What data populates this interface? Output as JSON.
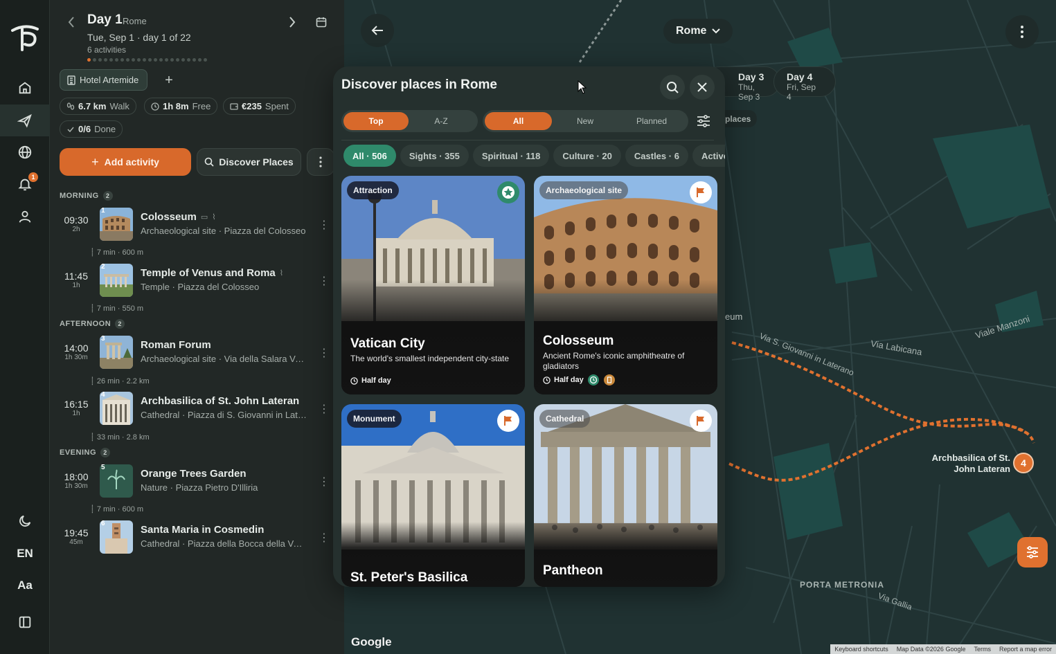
{
  "rail": {
    "items": [
      "home",
      "trips",
      "explore",
      "notifications",
      "profile"
    ],
    "notification_count": "1",
    "language": "EN",
    "font_label": "Aa"
  },
  "day": {
    "title": "Day 1",
    "city": "Rome",
    "subtitle": "Tue, Sep 1 · day 1 of 22",
    "activities": "6 activities",
    "total_days": 22,
    "current_day": 1
  },
  "hotel": {
    "label": "Hotel Artemide"
  },
  "stats": {
    "walk_value": "6.7 km",
    "walk_label": "Walk",
    "free_value": "1h 8m",
    "free_label": "Free",
    "spent_value": "€235",
    "spent_label": "Spent",
    "done_value": "0/6",
    "done_label": "Done"
  },
  "actions": {
    "add": "Add activity",
    "discover": "Discover Places"
  },
  "sections": [
    {
      "label": "MORNING",
      "count": "2"
    },
    {
      "label": "AFTERNOON",
      "count": "2"
    },
    {
      "label": "EVENING",
      "count": "2"
    }
  ],
  "activities": [
    {
      "num": "1",
      "time": "09:30",
      "dur": "2h",
      "name": "Colosseum",
      "meta": "Archaeological site · Piazza del Colosseo",
      "walk": "7 min · 600 m"
    },
    {
      "num": "2",
      "time": "11:45",
      "dur": "1h",
      "name": "Temple of Venus and Roma",
      "meta": "Temple · Piazza del Colosseo",
      "walk": "7 min · 550 m"
    },
    {
      "num": "3",
      "time": "14:00",
      "dur": "1h 30m",
      "name": "Roman Forum",
      "meta": "Archaeological site · Via della Salara Vecchia",
      "walk": "26 min · 2.2 km"
    },
    {
      "num": "4",
      "time": "16:15",
      "dur": "1h",
      "name": "Archbasilica of St. John Lateran",
      "meta": "Cathedral · Piazza di S. Giovanni in Laterano",
      "walk": "33 min · 2.8 km"
    },
    {
      "num": "5",
      "time": "18:00",
      "dur": "1h 30m",
      "name": "Orange Trees Garden",
      "meta": "Nature · Piazza Pietro D'Illiria",
      "walk": "7 min · 600 m"
    },
    {
      "num": "6",
      "time": "19:45",
      "dur": "45m",
      "name": "Santa Maria in Cosmedin",
      "meta": "Cathedral · Piazza della Bocca della Verità",
      "walk": ""
    }
  ],
  "map": {
    "city": "Rome",
    "day3_title": "Day 3",
    "day3_date": "Thu, Sep 3",
    "day4_title": "Day 4",
    "day4_date": "Fri, Sep 4",
    "places_chip": "places",
    "pin_number": "4",
    "pin_label": "Archbasilica of St. John Lateran",
    "streets": [
      "Via Labicana",
      "Viale Manzoni",
      "PORTA METRONIA",
      "Via Galilei",
      "Via Gallia",
      "Via S. Giovanni in Laterano",
      "eum"
    ],
    "google": "Google",
    "footer": [
      "Keyboard shortcuts",
      "Map Data ©2026 Google",
      "Terms",
      "Report a map error"
    ],
    "route_color": "#e0712f"
  },
  "modal": {
    "title": "Discover places in Rome",
    "sort": [
      "Top",
      "A-Z"
    ],
    "sort_selected": "Top",
    "status": [
      "All",
      "New",
      "Planned"
    ],
    "status_selected": "All",
    "categories": [
      "All · 506",
      "Sights · 355",
      "Spiritual · 118",
      "Culture · 20",
      "Castles · 6",
      "Active ·"
    ],
    "cards": [
      {
        "tag": "Attraction",
        "name": "Vatican City",
        "desc": "The world's smallest independent city-state",
        "info": "Half day",
        "badge": "star"
      },
      {
        "tag": "Archaeological site",
        "name": "Colosseum",
        "desc": "Ancient Rome's iconic amphitheatre of gladiators",
        "info": "Half day",
        "badge": "flag"
      },
      {
        "tag": "Monument",
        "name": "St. Peter's Basilica",
        "badge": "flag"
      },
      {
        "tag": "Cathedral",
        "name": "Pantheon",
        "badge": "flag"
      }
    ]
  },
  "colors": {
    "accent": "#d8692b",
    "green": "#2f8a6b",
    "panel": "#222826"
  }
}
